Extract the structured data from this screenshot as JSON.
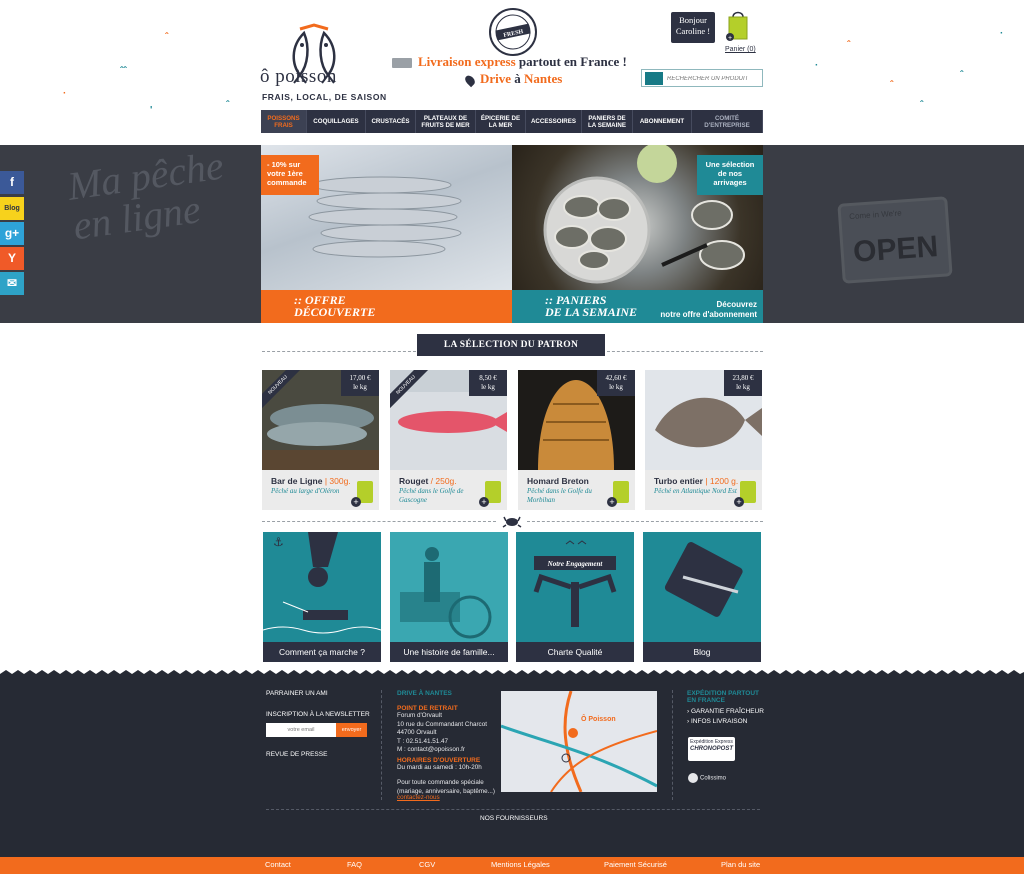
{
  "header": {
    "brand": "ô poisson",
    "tagline": "FRAIS, LOCAL, DE SAISON",
    "stamp_text": "EN DIRECT · FRESH · DU PORT",
    "delivery": {
      "highlight": "Livraison express",
      "rest": " partout en France !"
    },
    "drive": {
      "word": "Drive",
      "mid": " à ",
      "city": "Nantes"
    },
    "greeting": "Bonjour\nCaroline !",
    "cart_label": "Panier (0)",
    "search_placeholder": "RECHERCHER UN PRODUIT"
  },
  "nav": [
    {
      "label": "POISSONS FRAIS",
      "active": true
    },
    {
      "label": "COQUILLAGES"
    },
    {
      "label": "CRUSTACÉS"
    },
    {
      "label": "PLATEAUX DE FRUITS DE MER"
    },
    {
      "label": "ÉPICERIE DE LA MER"
    },
    {
      "label": "ACCESSOIRES"
    },
    {
      "label": "PANIERS DE LA SEMAINE"
    },
    {
      "label": "ABONNEMENT"
    },
    {
      "label": "COMITÉ D'ENTREPRISE"
    }
  ],
  "hero": {
    "bg_text": "Ma pêche en ligne",
    "open_small": "Come in We're",
    "open_big": "OPEN",
    "left": {
      "tag": "- 10% sur votre 1ère commande",
      "caption_1": ":: OFFRE",
      "caption_2": "DÉCOUVERTE"
    },
    "right": {
      "tag": "Une sélection de nos arrivages",
      "caption_1": ":: PANIERS",
      "caption_2": "DE LA SEMAINE",
      "sub_1": "Découvrez",
      "sub_2": "notre offre d'abonnement"
    }
  },
  "social": [
    {
      "name": "facebook",
      "glyph": "f",
      "color": "#3b5998"
    },
    {
      "name": "blog",
      "glyph": "Blog",
      "color": "#f7d21c"
    },
    {
      "name": "google-plus",
      "glyph": "g+",
      "color": "#2ea3d8"
    },
    {
      "name": "yummly",
      "glyph": "Y",
      "color": "#f05a28"
    },
    {
      "name": "email",
      "glyph": "✉",
      "color": "#2ea3c7"
    }
  ],
  "selection_title": "LA SÉLECTION DU PATRON",
  "products": [
    {
      "name": "Bar de Ligne",
      "weight": " | 300g.",
      "origin": "Pêché au large d'Oléron",
      "price": "17,00 €",
      "unit": "le kg",
      "badge": "NOUVEAU"
    },
    {
      "name": "Rouget",
      "weight": " / 250g.",
      "origin": "Pêché dans le Golfe de Gascogne",
      "price": "8,50 €",
      "unit": "le kg",
      "badge": "NOUVEAU"
    },
    {
      "name": "Homard Breton",
      "weight": "",
      "origin": "Pêché dans le Golfe du Morbihan",
      "price": "42,60 €",
      "unit": "le kg",
      "badge": ""
    },
    {
      "name": "Turbo entier",
      "weight": " | 1200 g.",
      "origin": "Pêché en Atlantique Nord Est",
      "price": "23,80 €",
      "unit": "le kg",
      "badge": ""
    }
  ],
  "tiles": [
    {
      "label": "Comment ça marche ?"
    },
    {
      "label": "Une histoire de famille..."
    },
    {
      "label": "Charte Qualité",
      "banner": "Notre Engagement"
    },
    {
      "label": "Blog"
    }
  ],
  "footer": {
    "sponsor": "PARRAINER UN AMI",
    "newsletter": "INSCRIPTION À LA NEWSLETTER",
    "email_placeholder": "votre email",
    "send": "envoyer",
    "press": "REVUE DE PRESSE",
    "drive_title": "DRIVE À NANTES",
    "pickup_title": "POINT DE RETRAIT",
    "pickup_lines": [
      "Forum d'Orvault",
      "10 rue du Commandant Charcot",
      "44700 Orvault",
      "T : 02.51.41.51.47",
      "M : contact@opoisson.fr"
    ],
    "hours_title": "HORAIRES D'OUVERTURE",
    "hours": "Du mardi au samedi : 10h-20h",
    "special_lines": [
      "Pour toute commande spéciale",
      "(mariage, anniversaire, baptême...)"
    ],
    "contact_us": "contactez-nous",
    "map_label": "Ô Poisson",
    "shipping_title_1": "EXPÉDITION PARTOUT",
    "shipping_title_2": "EN FRANCE",
    "guarantee": "› GARANTIE FRAÎCHEUR",
    "delivery_info": "› INFOS LIVRAISON",
    "chrono_top": "Expédition Express",
    "chrono_name": "CHRONOPOST",
    "colissimo": "Colissimo",
    "suppliers": "NOS FOURNISSEURS"
  },
  "bottom_links": [
    "Contact",
    "FAQ",
    "CGV",
    "Mentions Légales",
    "Paiement Sécurisé",
    "Plan du site"
  ]
}
